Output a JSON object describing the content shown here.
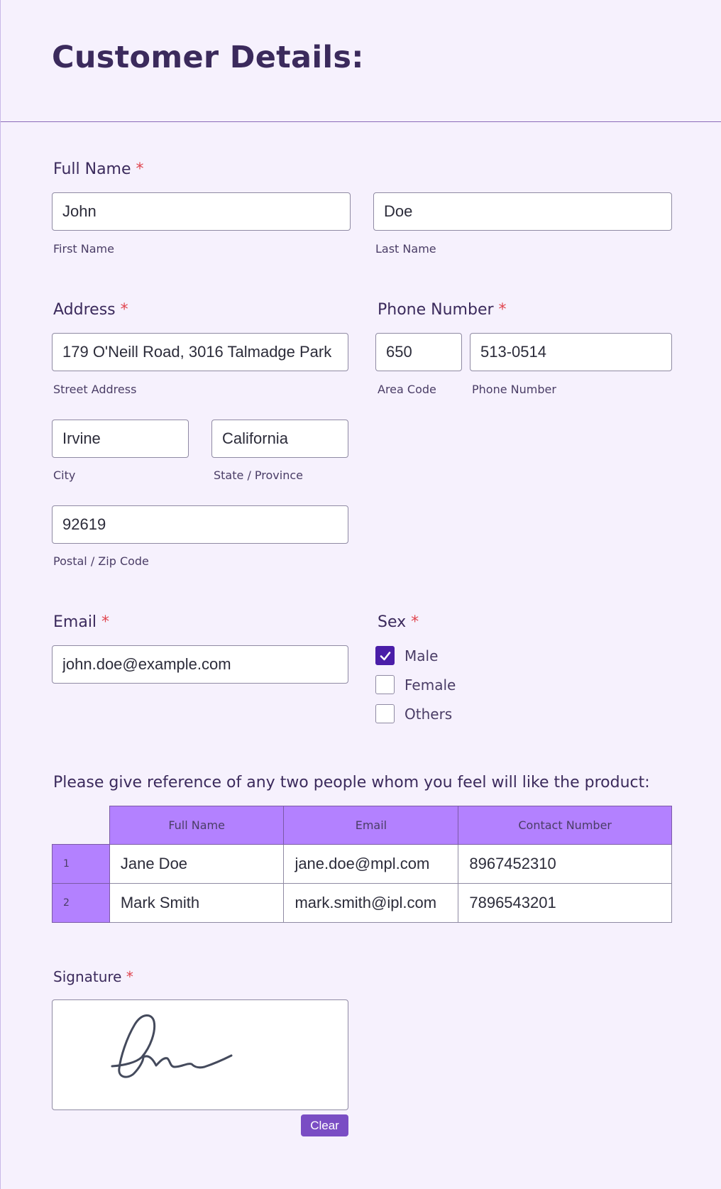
{
  "header": {
    "title": "Customer Details:"
  },
  "full_name": {
    "label": "Full Name",
    "required_mark": "*",
    "first": {
      "value": "John",
      "sublabel": "First Name"
    },
    "last": {
      "value": "Doe",
      "sublabel": "Last Name"
    }
  },
  "address": {
    "label": "Address",
    "required_mark": "*",
    "street": {
      "value": "179 O'Neill Road, 3016 Talmadge Park",
      "sublabel": "Street Address"
    },
    "city": {
      "value": "Irvine",
      "sublabel": "City"
    },
    "state": {
      "value": "California",
      "sublabel": "State / Province"
    },
    "postal": {
      "value": "92619",
      "sublabel": "Postal / Zip Code"
    }
  },
  "phone": {
    "label": "Phone Number",
    "required_mark": "*",
    "area": {
      "value": "650",
      "sublabel": "Area Code"
    },
    "number": {
      "value": "513-0514",
      "sublabel": "Phone Number"
    }
  },
  "email": {
    "label": "Email",
    "required_mark": "*",
    "value": "john.doe@example.com"
  },
  "sex": {
    "label": "Sex",
    "required_mark": "*",
    "options": [
      {
        "label": "Male",
        "checked": true
      },
      {
        "label": "Female",
        "checked": false
      },
      {
        "label": "Others",
        "checked": false
      }
    ]
  },
  "references": {
    "question": "Please give reference of any two people whom you feel will like the product:",
    "columns": [
      "Full Name",
      "Email",
      "Contact Number"
    ],
    "rows": [
      {
        "num": "1",
        "name": "Jane Doe",
        "email": "jane.doe@mpl.com",
        "contact": "8967452310"
      },
      {
        "num": "2",
        "name": "Mark Smith",
        "email": "mark.smith@ipl.com",
        "contact": "7896543201"
      }
    ]
  },
  "signature": {
    "label": "Signature",
    "required_mark": "*",
    "clear_label": "Clear"
  },
  "colors": {
    "accent": "#4a1ea8",
    "table_header": "#b381ff",
    "clear_button": "#7a4dc4",
    "required": "#e0454f"
  }
}
